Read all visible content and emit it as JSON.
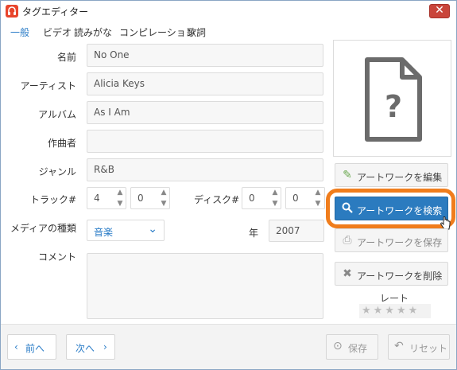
{
  "window": {
    "title": "タグエディター",
    "close_label": "✕"
  },
  "tabs": [
    {
      "label": "一般",
      "active": true
    },
    {
      "label": "ビデオ"
    },
    {
      "label": "読みがな"
    },
    {
      "label": "コンピレーション"
    },
    {
      "label": "歌詞"
    }
  ],
  "form": {
    "name_label": "名前",
    "name_value": "No One",
    "artist_label": "アーティスト",
    "artist_value": "Alicia Keys",
    "album_label": "アルバム",
    "album_value": "As I Am",
    "composer_label": "作曲者",
    "composer_value": "",
    "genre_label": "ジャンル",
    "genre_value": "R&B",
    "track_label": "トラック#",
    "track_number": "4",
    "track_total": "0",
    "disc_label": "ディスク#",
    "disc_number": "0",
    "disc_total": "0",
    "media_kind_label": "メディアの種類",
    "media_kind_value": "音楽",
    "year_label": "年",
    "year_value": "2007",
    "comment_label": "コメント",
    "comment_value": ""
  },
  "artwork": {
    "placeholder_icon": "question-file-icon",
    "edit_label": "アートワークを編集",
    "search_label": "アートワークを検索",
    "save_label": "アートワークを保存",
    "delete_label": "アートワークを削除"
  },
  "rating": {
    "label": "レート",
    "stars": 0,
    "max": 5,
    "star_glyphs": "★★★★★"
  },
  "footer": {
    "prev_label": "前へ",
    "next_label": "次へ",
    "save_label": "保存",
    "reset_label": "リセット"
  },
  "colors": {
    "accent": "#2a7cc7",
    "primary_button": "#2b7bbf",
    "highlight": "#f07d1c",
    "close": "#c9453b"
  }
}
